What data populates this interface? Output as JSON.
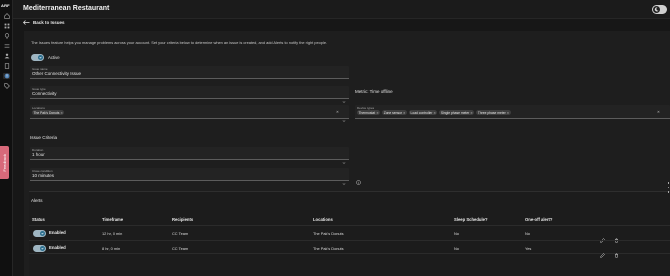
{
  "app": {
    "logo": "ARF",
    "title": "Mediterranean Restaurant"
  },
  "feedback": "Feedback",
  "back_label": "Back to Issues",
  "description": "The Issues feature helps you manage problems across your account. Set your criteria below to determine when an issue is created, and add Alerts to notify the right people.",
  "active": {
    "label": "Active",
    "on": true
  },
  "issue_name": {
    "label": "Issue name",
    "value": "Other Connectivity Issue"
  },
  "issue_type": {
    "label": "Issue type",
    "value": "Connectivity"
  },
  "metric_label": "Metric: Time offline",
  "locations": {
    "label": "Locations",
    "chips": [
      "The Pak's Donuts"
    ]
  },
  "device_types": {
    "label": "Device types",
    "chips": [
      "Thermostat",
      "Zone sensor",
      "Load controller",
      "Single phase meter",
      "Three phase meter"
    ]
  },
  "criteria_title": "Issue Criteria",
  "duration": {
    "label": "Duration",
    "value": "1 hour"
  },
  "close_condition": {
    "label": "Close condition",
    "value": "10 minutes"
  },
  "alerts": {
    "title": "Alerts",
    "columns": [
      "Status",
      "Timeframe",
      "Recipients",
      "Locations",
      "Sleep Schedule?",
      "One-off alert?"
    ],
    "rows": [
      {
        "status": "Enabled",
        "timeframe": "12 hr, 0 min",
        "recipients": "CC Team",
        "locations": "The Pak's Donuts",
        "sleep": "No",
        "oneoff": "No"
      },
      {
        "status": "Enabled",
        "timeframe": "8 hr, 0 min",
        "recipients": "CC Team",
        "locations": "The Pak's Donuts",
        "sleep": "No",
        "oneoff": "Yes"
      }
    ]
  },
  "icons": [
    "home-icon",
    "grid-icon",
    "location-icon",
    "tune-icon",
    "user-icon",
    "document-icon",
    "alert-icon",
    "tag-icon"
  ],
  "colors": {
    "accent": "#2c6f8f",
    "feedback": "#d8697a",
    "background": "#171717"
  }
}
